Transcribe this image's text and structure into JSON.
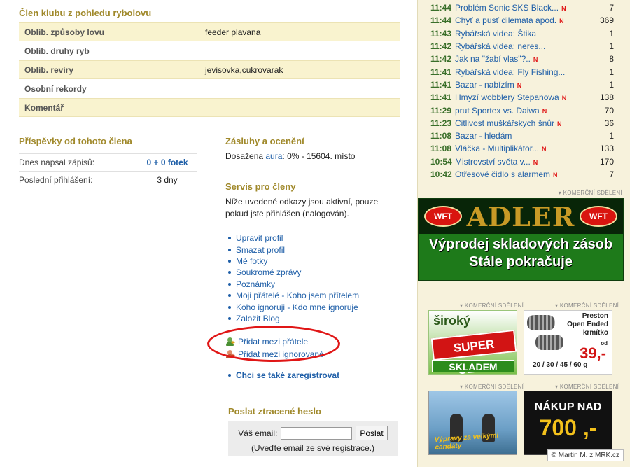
{
  "club": {
    "title": "Člen klubu z pohledu rybolovu",
    "rows": [
      {
        "label": "Oblíb. způsoby lovu",
        "value": "feeder plavana"
      },
      {
        "label": "Oblíb. druhy ryb",
        "value": ""
      },
      {
        "label": "Oblíb. revíry",
        "value": "jevisovka,cukrovarak"
      },
      {
        "label": "Osobní rekordy",
        "value": ""
      },
      {
        "label": "Komentář",
        "value": ""
      }
    ]
  },
  "posts": {
    "title": "Příspěvky od tohoto člena",
    "today_label": "Dnes napsal zápisů:",
    "today_value": "0 + 0 fotek",
    "lastlogin_label": "Poslední přihlášení:",
    "lastlogin_value": "3 dny"
  },
  "merit": {
    "title": "Zásluhy a ocenění",
    "prefix": "Dosažena ",
    "aura_link": "aura",
    "suffix": ": 0% - 15604. místo"
  },
  "service": {
    "title": "Servis pro členy",
    "note": "Níže uvedené odkazy jsou aktivní, pouze pokud jste přihlášen (nalogován).",
    "links": [
      "Upravit profil",
      "Smazat profil",
      "Mé fotky",
      "Soukromé zprávy",
      "Poznámky",
      "Moji přátelé - Koho jsem přítelem",
      "Koho ignoruji - Kdo mne ignoruje",
      "Založit Blog"
    ],
    "add_friend": "Přidat mezi přátele",
    "add_ignored": "Přidat mezi ignorované",
    "register": "Chci se také zaregistrovat"
  },
  "lostpw": {
    "title": "Poslat ztracené heslo",
    "email_label": "Váš email:",
    "email_value": "",
    "send_label": "Poslat",
    "hint": "(Uveďte email ze své registrace.)"
  },
  "feed": [
    {
      "time": "11:44",
      "title": "Problém Sonic SKS Black...",
      "new": true,
      "count": "7"
    },
    {
      "time": "11:44",
      "title": "Chyť a pusť dilemata apod.",
      "new": true,
      "count": "369"
    },
    {
      "time": "11:43",
      "title": "Rybářská videa: Štika",
      "new": false,
      "count": "1"
    },
    {
      "time": "11:42",
      "title": "Rybářská videa: neres...",
      "new": false,
      "count": "1"
    },
    {
      "time": "11:42",
      "title": "Jak na \"žabí vlas\"?..",
      "new": true,
      "count": "8"
    },
    {
      "time": "11:41",
      "title": "Rybářská videa: Fly Fishing...",
      "new": false,
      "count": "1"
    },
    {
      "time": "11:41",
      "title": "Bazar - nabízím",
      "new": true,
      "count": "1"
    },
    {
      "time": "11:41",
      "title": "Hmyzí wobblery Stepanowa",
      "new": true,
      "count": "138"
    },
    {
      "time": "11:29",
      "title": "prut Sportex vs. Daiwa",
      "new": true,
      "count": "70"
    },
    {
      "time": "11:23",
      "title": "Citlivost muškářskych šnůr",
      "new": true,
      "count": "36"
    },
    {
      "time": "11:08",
      "title": "Bazar - hledám",
      "new": false,
      "count": "1"
    },
    {
      "time": "11:08",
      "title": "Vláčka - Multiplikátor...",
      "new": true,
      "count": "133"
    },
    {
      "time": "10:54",
      "title": "Mistrovství světa v...",
      "new": true,
      "count": "170"
    },
    {
      "time": "10:42",
      "title": "Otřesové čidlo s alarmem",
      "new": true,
      "count": "7"
    }
  ],
  "new_marker": "N",
  "ads": {
    "label": "▾ KOMERČNÍ SDĚLENÍ",
    "adler_brand": "ADLER",
    "adler_wft": "WFT",
    "adler_line1": "Výprodej skladových zásob",
    "adler_line2": "Stále pokračuje",
    "super_top": "široký",
    "super_stamp": "SUPER CENY!",
    "super_stock": "SKLADEM",
    "preston_title_1": "Preston",
    "preston_title_2": "Open Ended",
    "preston_title_3": "krmítko",
    "preston_od": "od",
    "preston_price": "39,-",
    "preston_sizes": "20 / 30 / 45 / 60 g",
    "sumec_caption": "Výpravy za velkými candáty",
    "nakup_1": "NÁKUP NAD",
    "nakup_2": "700 ,-"
  },
  "copyright": "© Martin M. z MRK.cz",
  "colors": {
    "accent_title": "#a0892b",
    "link": "#1f5fa8",
    "highlight_ellipse": "#e01616",
    "new_marker": "#e01616"
  }
}
